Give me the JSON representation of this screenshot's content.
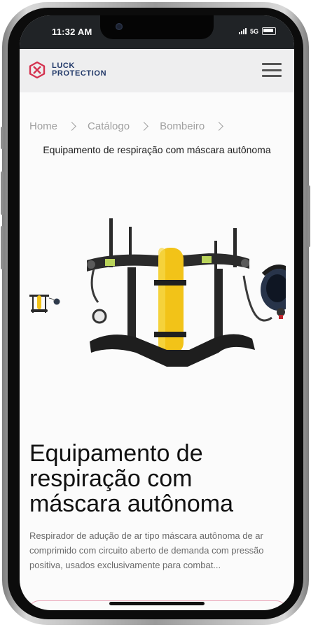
{
  "status_bar": {
    "time": "11:32 AM",
    "network": "5G"
  },
  "header": {
    "brand_line1": "LUCK",
    "brand_line2": "PROTECTION",
    "menu_icon": "hamburger-menu-icon"
  },
  "breadcrumb": {
    "items": [
      "Home",
      "Catálogo",
      "Bombeiro"
    ]
  },
  "product": {
    "subtitle": "Equipamento de respiração com máscara autônoma",
    "title": "Equipamento de respiração com máscara autônoma",
    "description": "Respirador de adução de ar tipo máscara autônoma de ar comprimido com circuito aberto de demanda com pressão positiva, usados exclusivamente para combat...",
    "image_icon": "breathing-apparatus-image"
  },
  "colors": {
    "brand_red": "#d4324f",
    "brand_navy": "#233a6a",
    "status_bar_bg": "#202326",
    "header_bg": "#eeeeef",
    "cta_border": "#e9a4b7"
  }
}
